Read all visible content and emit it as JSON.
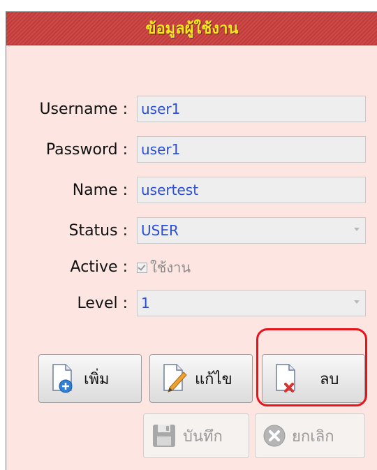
{
  "title": "ข้อมูลผู้ใช้งาน",
  "form": {
    "username": {
      "label": "Username :",
      "value": "user1"
    },
    "password": {
      "label": "Password :",
      "value": "user1"
    },
    "name": {
      "label": "Name :",
      "value": "usertest"
    },
    "status": {
      "label": "Status :",
      "value": "USER"
    },
    "active": {
      "label": "Active :",
      "checkbox_label": "ใช้งาน",
      "checked": true
    },
    "level": {
      "label": "Level :",
      "value": "1"
    }
  },
  "buttons": {
    "add": "เพิ่ม",
    "edit": "แก้ไข",
    "delete": "ลบ",
    "save": "บันทึก",
    "cancel": "ยกเลิก"
  },
  "colors": {
    "panel_bg": "#fde6e2",
    "title_bar": "#c84443",
    "title_text": "#f3e81a",
    "field_text": "#2a4fd6",
    "highlight": "#e8131a"
  }
}
